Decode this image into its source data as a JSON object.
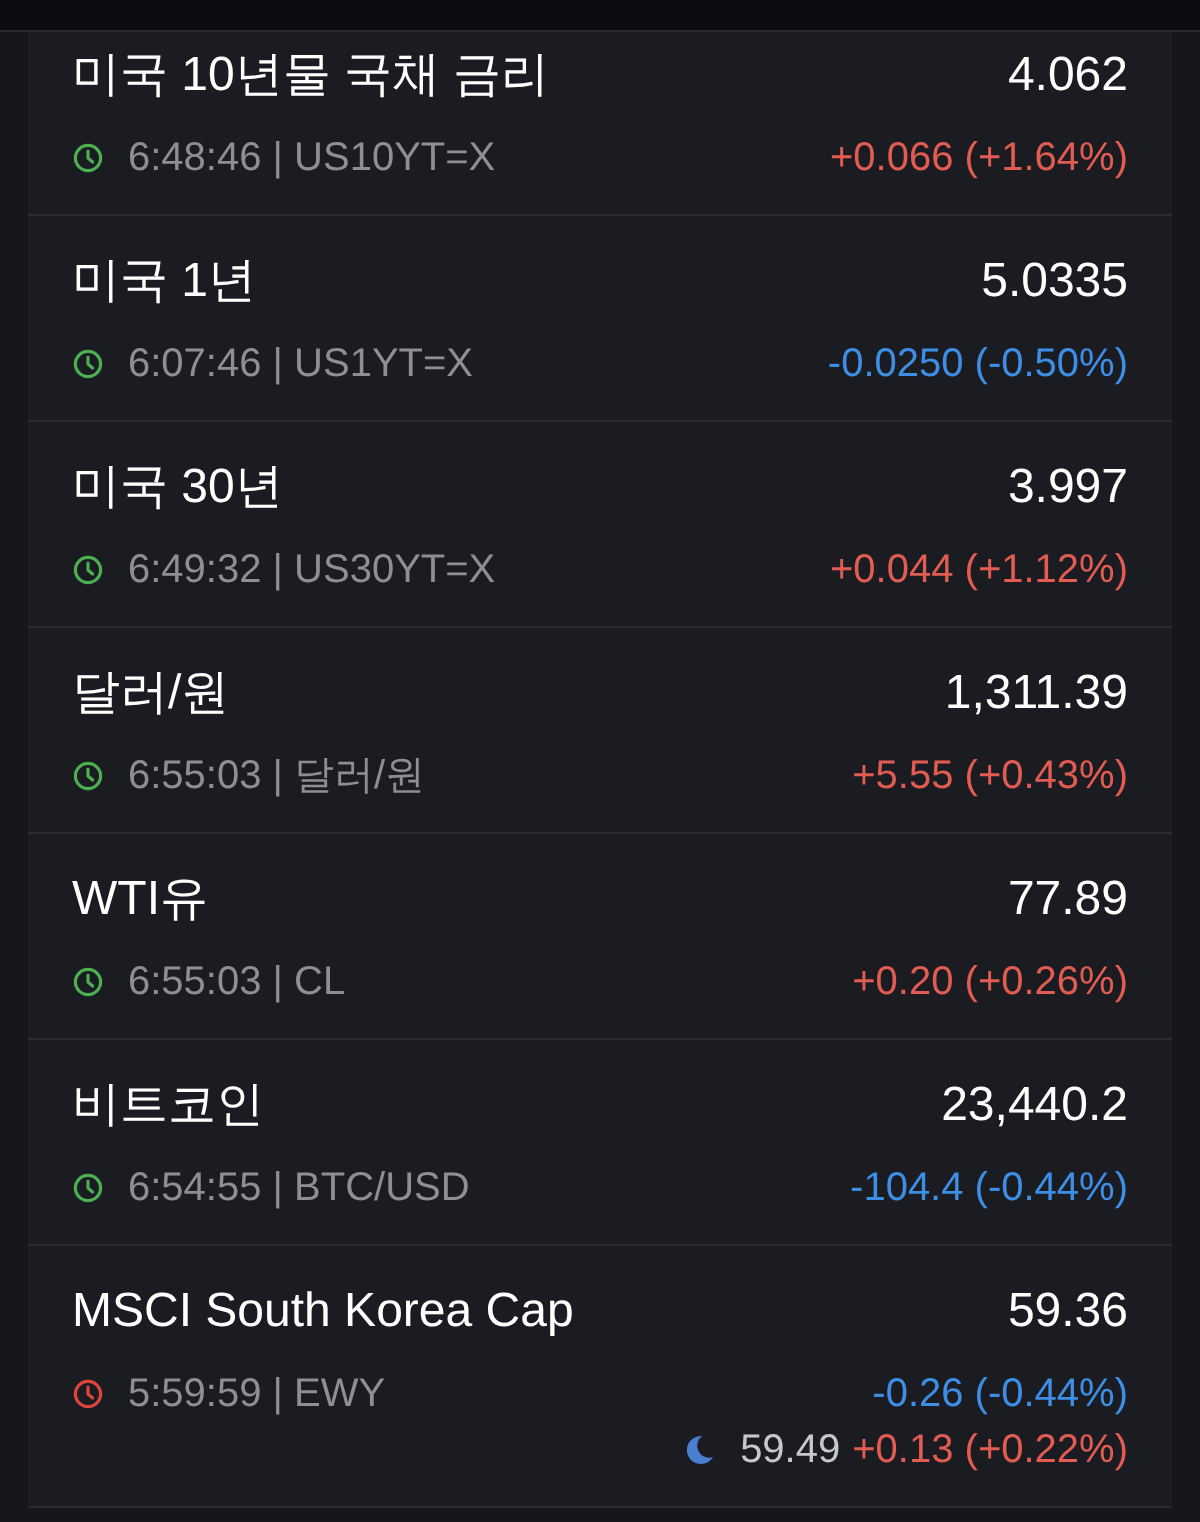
{
  "quotes": [
    {
      "name": "미국 10년물 국채 금리",
      "price": "4.062",
      "market_open": true,
      "subtitle": "6:48:46 | US10YT=X",
      "change": "+0.066 (+1.64%)",
      "rising": true
    },
    {
      "name": "미국 1년",
      "price": "5.0335",
      "market_open": true,
      "subtitle": "6:07:46 | US1YT=X",
      "change": "-0.0250 (-0.50%)",
      "rising": false
    },
    {
      "name": "미국 30년",
      "price": "3.997",
      "market_open": true,
      "subtitle": "6:49:32 | US30YT=X",
      "change": "+0.044 (+1.12%)",
      "rising": true
    },
    {
      "name": "달러/원",
      "price": "1,311.39",
      "market_open": true,
      "subtitle": "6:55:03 | 달러/원",
      "change": "+5.55 (+0.43%)",
      "rising": true
    },
    {
      "name": "WTI유",
      "price": "77.89",
      "market_open": true,
      "subtitle": "6:55:03 | CL",
      "change": "+0.20 (+0.26%)",
      "rising": true
    },
    {
      "name": "비트코인",
      "price": "23,440.2",
      "market_open": true,
      "subtitle": "6:54:55 | BTC/USD",
      "change": "-104.4 (-0.44%)",
      "rising": false
    },
    {
      "name": "MSCI South Korea Cap",
      "price": "59.36",
      "market_open": false,
      "subtitle": "5:59:59 | EWY",
      "change": "-0.26 (-0.44%)",
      "rising": false,
      "after_hours": {
        "price": "59.49",
        "change": "+0.13 (+0.22%)",
        "rising": true
      }
    }
  ]
}
